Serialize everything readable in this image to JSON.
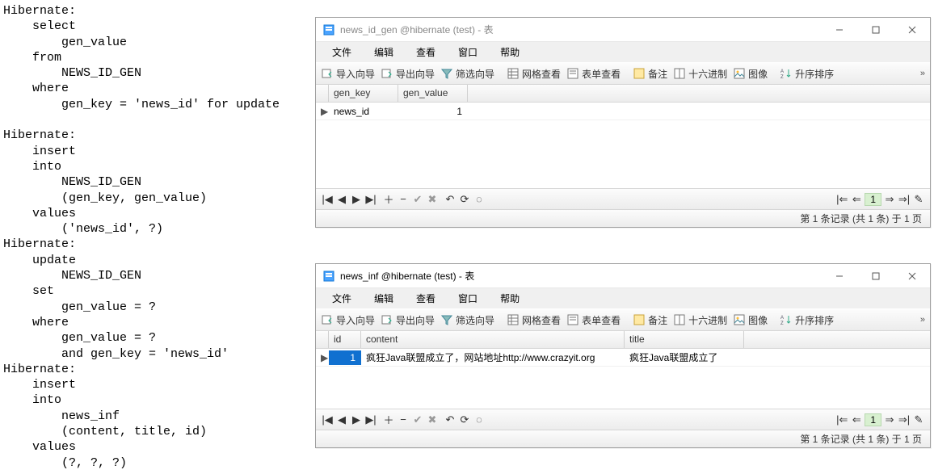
{
  "code_left": "Hibernate:\n    select\n        gen_value \n    from\n        NEWS_ID_GEN \n    where\n        gen_key = 'news_id' for update\n            \nHibernate:\n    insert \n    into\n        NEWS_ID_GEN\n        (gen_key, gen_value) \n    values\n        ('news_id', ?)\nHibernate:\n    update\n        NEWS_ID_GEN \n    set\n        gen_value = ? \n    where\n        gen_value = ? \n        and gen_key = 'news_id'\nHibernate:\n    insert \n    into\n        news_inf\n        (content, title, id) \n    values\n        (?, ?, ?)",
  "menubar": {
    "items": [
      "文件",
      "编辑",
      "查看",
      "窗口",
      "帮助"
    ]
  },
  "toolbar": {
    "import": "导入向导",
    "export": "导出向导",
    "filter": "筛选向导",
    "gridview": "网格查看",
    "formview": "表单查看",
    "memo": "备注",
    "hex": "十六进制",
    "image": "图像",
    "sortasc": "升序排序"
  },
  "win1": {
    "title": "news_id_gen @hibernate (test) - 表",
    "cols": [
      "gen_key",
      "gen_value"
    ],
    "rows": [
      {
        "gen_key": "news_id",
        "gen_value": "1"
      }
    ],
    "status": "第 1 条记录 (共 1 条) 于 1 页",
    "page": "1"
  },
  "win2": {
    "title": "news_inf @hibernate (test) - 表",
    "cols": [
      "id",
      "content",
      "title"
    ],
    "rows": [
      {
        "id": "1",
        "content": "疯狂Java联盟成立了，网站地址http://www.crazyit.org",
        "title": "疯狂Java联盟成立了"
      }
    ],
    "status": "第 1 条记录 (共 1 条) 于 1 页",
    "page": "1"
  }
}
